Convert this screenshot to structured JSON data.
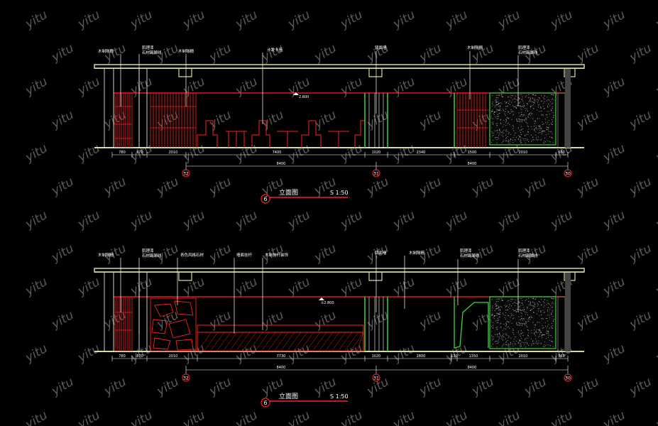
{
  "watermark": {
    "text": "yitu",
    "color": "#5a5a5a"
  },
  "colors": {
    "background": "#000000",
    "slab": "#d8d8a0",
    "dim": "#ffffff",
    "red": "#ff2020",
    "green": "#3ad63a",
    "leader": "#ffffff",
    "grid_circle": "#ff2020"
  },
  "elevations": [
    {
      "id": "top",
      "labels": [
        "木制隔栅",
        "肌理漆",
        "石材踢脚线",
        "木制隔栅",
        "沙发卡座",
        "镜面墙",
        "木制隔栅",
        "肌理漆",
        "石材踢脚线"
      ],
      "level_mark": "2.800",
      "dims_row1": [
        "780",
        "870",
        "2010",
        "7400",
        "1020",
        "2340",
        "1500",
        "2010",
        "560"
      ],
      "dims_row2": [
        "8400",
        "8400"
      ],
      "grid_ids": [
        "32",
        "31",
        "30"
      ],
      "title": "立面图",
      "scale": "S 1:50",
      "number": "6"
    },
    {
      "id": "bottom",
      "labels": [
        "木制隔栅",
        "肌理漆",
        "石材踢脚线",
        "青色风格石材",
        "墙面挂杆",
        "木制挂杆装饰",
        "镜面墙",
        "木制隔栅",
        "肌理漆",
        "石材踢脚线",
        "肌理漆",
        "石材踢脚线"
      ],
      "level_mark": "±2.800",
      "dims_row1": [
        "780",
        "870",
        "2010",
        "7730",
        "1020",
        "2800",
        "130",
        "1350",
        "2010",
        "560"
      ],
      "dims_row2": [
        "8400",
        "8400"
      ],
      "grid_ids": [
        "32",
        "31",
        "30"
      ],
      "title": "立面图",
      "scale": "S 1:50",
      "number": "6"
    }
  ]
}
